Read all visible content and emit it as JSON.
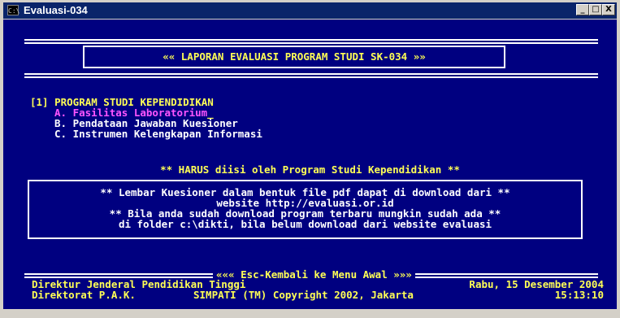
{
  "window": {
    "title": "Evaluasi-034",
    "icon_label": "C:\\",
    "controls": {
      "minimize": "_",
      "maximize": "□",
      "close": "X"
    }
  },
  "header": {
    "banner": "«« LAPORAN EVALUASI PROGRAM STUDI SK-034 »»"
  },
  "menu": {
    "section_title": "[1] PROGRAM STUDI KEPENDIDIKAN",
    "items": [
      {
        "label": "A. Fasilitas Laboratorium",
        "selected": true
      },
      {
        "label": "B. Pendataan Jawaban Kuesioner",
        "selected": false
      },
      {
        "label": "C. Instrumen Kelengkapan Informasi",
        "selected": false
      }
    ],
    "cursor": "_"
  },
  "notice": "** HARUS diisi oleh Program Studi Kependidikan **",
  "info_box": {
    "lines": [
      "** Lembar Kuesioner dalam bentuk file pdf dapat di download dari **",
      "website http://evaluasi.or.id",
      "** Bila anda sudah download program terbaru mungkin sudah ada **",
      "di folder c:\\dikti, bila belum download dari website evaluasi"
    ]
  },
  "footer": {
    "back_label": "««« Esc-Kembali ke Menu Awal »»»",
    "org_line1": "Direktur Jenderal Pendidikan Tinggi",
    "org_line2": "Direktorat P.A.K.",
    "copyright": "SIMPATI (TM) Copyright 2002, Jakarta",
    "date": "Rabu, 15 Desember 2004",
    "time": "15:13:10"
  },
  "colors": {
    "console_bg": "#000080",
    "text_yellow": "#ffff55",
    "text_white": "#ffffff",
    "text_magenta": "#ff55ff",
    "titlebar_bg": "#0a246a"
  }
}
